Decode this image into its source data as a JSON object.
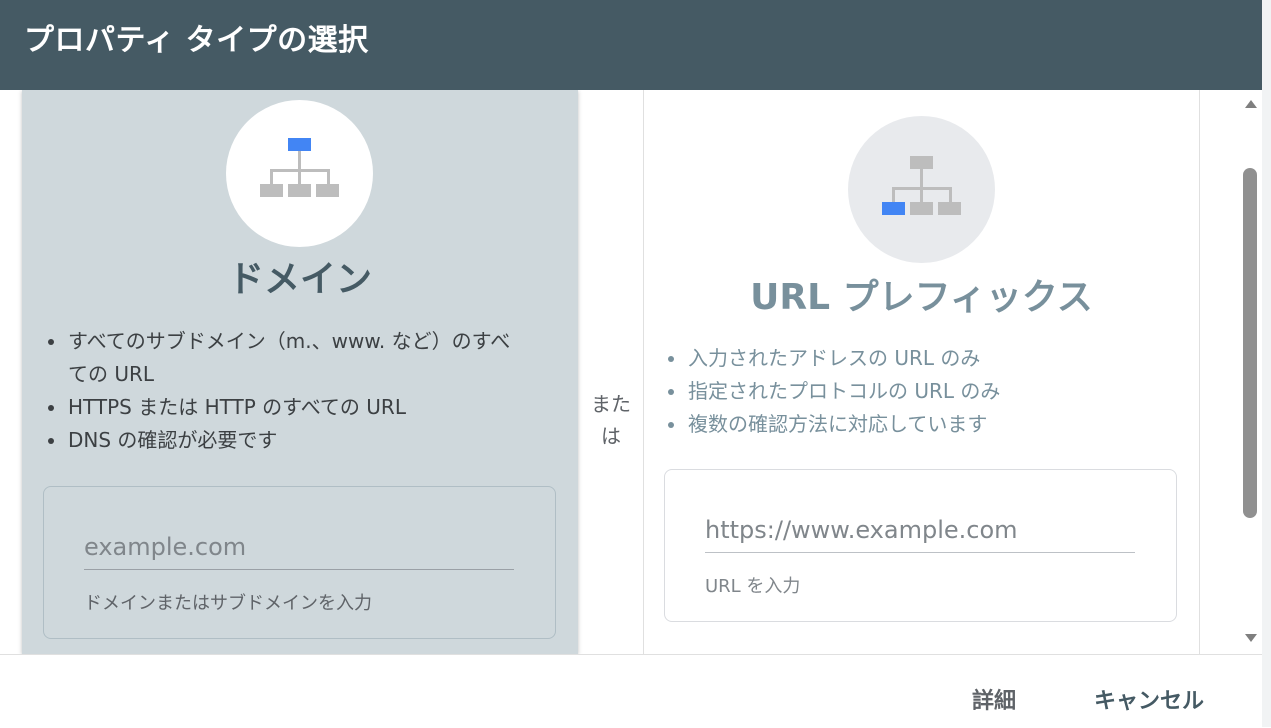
{
  "dialog": {
    "title": "プロパティ タイプの選択"
  },
  "domain": {
    "title": "ドメイン",
    "bullets": [
      "すべてのサブドメイン（m.、www. など）のすべての URL",
      "HTTPS または HTTP のすべての URL",
      "DNS の確認が必要です"
    ],
    "input_placeholder": "example.com",
    "input_hint": "ドメインまたはサブドメインを入力",
    "icon": "sitemap-top-highlight-icon"
  },
  "or_label_1": "また",
  "or_label_2": "は",
  "url_prefix": {
    "title": "URL プレフィックス",
    "bullets": [
      "入力されたアドレスの URL のみ",
      "指定されたプロトコルの URL のみ",
      "複数の確認方法に対応しています"
    ],
    "input_placeholder": "https://www.example.com",
    "input_hint": "URL を入力",
    "icon": "sitemap-leaf-highlight-icon"
  },
  "footer": {
    "detail_label": "詳細",
    "cancel_label": "キャンセル"
  },
  "colors": {
    "header_bg": "#455a64",
    "domain_card_bg": "#cfd8dc",
    "accent_blue": "#4285f4",
    "icon_gray": "#bdbdbd"
  }
}
